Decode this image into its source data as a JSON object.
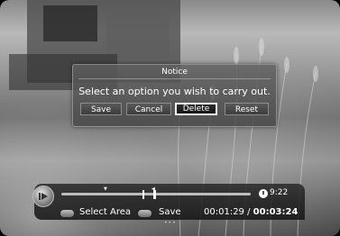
{
  "dialog": {
    "title": "Notice",
    "message": "Select an option you wish to carry out.",
    "buttons": [
      {
        "label": "Save",
        "selected": false
      },
      {
        "label": "Cancel",
        "selected": false
      },
      {
        "label": "Delete",
        "selected": true
      },
      {
        "label": "Reset",
        "selected": false
      }
    ]
  },
  "osd": {
    "clock": "9:22",
    "hints": {
      "select_area": "Select Area",
      "save": "Save"
    },
    "current_time": "00:01:29",
    "separator": "/",
    "total_time": "00:03:24",
    "page_dots": "•••"
  },
  "colors": {
    "selected_border": "#f2f2f2",
    "text": "#ffffff"
  },
  "icons": [
    "wheat-field-background",
    "play-icon",
    "clock-icon",
    "remote-key-icon"
  ]
}
